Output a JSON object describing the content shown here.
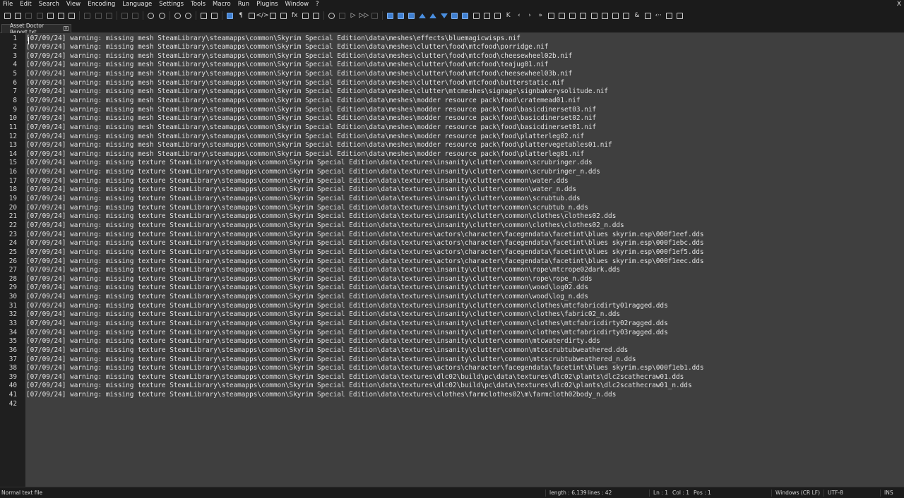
{
  "menu": {
    "items": [
      "File",
      "Edit",
      "Search",
      "View",
      "Encoding",
      "Language",
      "Settings",
      "Tools",
      "Macro",
      "Run",
      "Plugins",
      "Window",
      "?"
    ],
    "close_label": "X"
  },
  "toolbar": {
    "buttons": [
      {
        "name": "new-file-icon",
        "style": "",
        "disabled": false
      },
      {
        "name": "open-file-icon",
        "style": "",
        "disabled": false
      },
      {
        "name": "save-icon",
        "style": "",
        "disabled": true
      },
      {
        "name": "save-all-icon",
        "style": "",
        "disabled": true
      },
      {
        "name": "close-icon",
        "style": "",
        "disabled": false
      },
      {
        "name": "close-all-icon",
        "style": "",
        "disabled": false
      },
      {
        "name": "print-icon",
        "style": "",
        "disabled": false
      },
      {
        "sep": true
      },
      {
        "name": "cut-icon",
        "style": "",
        "disabled": true
      },
      {
        "name": "copy-icon",
        "style": "",
        "disabled": true
      },
      {
        "name": "paste-icon",
        "style": "",
        "disabled": true
      },
      {
        "sep": true
      },
      {
        "name": "undo-icon",
        "style": "",
        "disabled": true
      },
      {
        "name": "redo-icon",
        "style": "",
        "disabled": true
      },
      {
        "sep": true
      },
      {
        "name": "find-icon",
        "style": "round",
        "disabled": false
      },
      {
        "name": "replace-icon",
        "style": "round",
        "disabled": false
      },
      {
        "sep": true
      },
      {
        "name": "zoom-in-icon",
        "style": "round",
        "disabled": false
      },
      {
        "name": "zoom-out-icon",
        "style": "round",
        "disabled": false
      },
      {
        "sep": true
      },
      {
        "name": "sync-vertical-icon",
        "style": "",
        "disabled": false
      },
      {
        "name": "sync-horizontal-icon",
        "style": "",
        "disabled": false
      },
      {
        "sep": true
      },
      {
        "name": "word-wrap-icon",
        "style": "blue",
        "disabled": false
      },
      {
        "name": "show-all-characters-icon",
        "style": "glyph",
        "glyph": "¶",
        "disabled": false
      },
      {
        "name": "indent-guide-icon",
        "style": "",
        "disabled": false
      },
      {
        "name": "user-defined-language-icon",
        "style": "glyph",
        "glyph": "</>",
        "disabled": false
      },
      {
        "name": "document-map-icon",
        "style": "",
        "disabled": false
      },
      {
        "name": "document-list-icon",
        "style": "",
        "disabled": false
      },
      {
        "name": "function-list-icon",
        "style": "glyph",
        "glyph": "fx",
        "disabled": false
      },
      {
        "name": "folder-as-workspace-icon",
        "style": "",
        "disabled": false
      },
      {
        "name": "monitoring-icon",
        "style": "",
        "disabled": false
      },
      {
        "sep": true
      },
      {
        "name": "record-macro-icon",
        "style": "round",
        "disabled": false
      },
      {
        "name": "stop-recording-icon",
        "style": "",
        "disabled": true
      },
      {
        "name": "playback-macro-icon",
        "style": "glyph",
        "glyph": "▷",
        "disabled": false
      },
      {
        "name": "run-macro-multiple-icon",
        "style": "glyph",
        "glyph": "▷▷",
        "disabled": false
      },
      {
        "name": "save-macro-icon",
        "style": "",
        "disabled": true
      },
      {
        "sep": true
      },
      {
        "name": "plugin-1-icon",
        "style": "blue",
        "disabled": false
      },
      {
        "name": "plugin-2-icon",
        "style": "blue",
        "disabled": false
      },
      {
        "name": "plugin-3-icon",
        "style": "blue",
        "disabled": false
      },
      {
        "name": "plugin-4-icon",
        "style": "tri",
        "disabled": false
      },
      {
        "name": "plugin-5-icon",
        "style": "tri",
        "disabled": false
      },
      {
        "name": "plugin-6-icon",
        "style": "tri-down",
        "disabled": false
      },
      {
        "name": "plugin-7-icon",
        "style": "blue",
        "disabled": false
      },
      {
        "name": "plugin-8-icon",
        "style": "blue",
        "disabled": false
      },
      {
        "name": "plugin-9-icon",
        "style": "",
        "disabled": false
      },
      {
        "name": "plugin-10-icon",
        "style": "",
        "disabled": false
      },
      {
        "name": "plugin-11-icon",
        "style": "",
        "disabled": false
      },
      {
        "name": "plugin-12-icon",
        "style": "glyph",
        "glyph": "K",
        "disabled": false
      },
      {
        "name": "plugin-13-icon",
        "style": "glyph",
        "glyph": "‹",
        "disabled": false
      },
      {
        "name": "plugin-14-icon",
        "style": "glyph",
        "glyph": "›",
        "disabled": false
      },
      {
        "name": "plugin-15-icon",
        "style": "glyph",
        "glyph": "»",
        "disabled": false
      },
      {
        "name": "plugin-16-icon",
        "style": "",
        "disabled": false
      },
      {
        "name": "plugin-17-icon",
        "style": "",
        "disabled": false
      },
      {
        "name": "plugin-18-icon",
        "style": "",
        "disabled": false
      },
      {
        "name": "plugin-19-icon",
        "style": "",
        "disabled": false
      },
      {
        "name": "plugin-20-icon",
        "style": "",
        "disabled": false
      },
      {
        "name": "plugin-21-icon",
        "style": "",
        "disabled": false
      },
      {
        "name": "plugin-22-icon",
        "style": "",
        "disabled": false
      },
      {
        "name": "plugin-23-icon",
        "style": "",
        "disabled": false
      },
      {
        "name": "plugin-24-icon",
        "style": "glyph",
        "glyph": "&",
        "disabled": false
      },
      {
        "name": "plugin-25-icon",
        "style": "",
        "disabled": false
      },
      {
        "name": "plugin-26-icon",
        "style": "glyph",
        "glyph": "‹··",
        "disabled": false
      },
      {
        "name": "plugin-27-icon",
        "style": "",
        "disabled": false
      },
      {
        "name": "plugin-28-icon",
        "style": "",
        "disabled": false
      }
    ]
  },
  "tab": {
    "title": "Asset Doctor Report.txt",
    "close_glyph": "×"
  },
  "editor": {
    "lines": [
      "[07/09/24] warning: missing mesh SteamLibrary\\steamapps\\common\\Skyrim Special Edition\\data\\meshes\\effects\\bluemagicwisps.nif",
      "[07/09/24] warning: missing mesh SteamLibrary\\steamapps\\common\\Skyrim Special Edition\\data\\meshes\\clutter\\food\\mtcfood\\porridge.nif",
      "[07/09/24] warning: missing mesh SteamLibrary\\steamapps\\common\\Skyrim Special Edition\\data\\meshes\\clutter\\food\\mtcfood\\cheesewheel02b.nif",
      "[07/09/24] warning: missing mesh SteamLibrary\\steamapps\\common\\Skyrim Special Edition\\data\\meshes\\clutter\\food\\mtcfood\\teajug01.nif",
      "[07/09/24] warning: missing mesh SteamLibrary\\steamapps\\common\\Skyrim Special Edition\\data\\meshes\\clutter\\food\\mtcfood\\cheesewheel03b.nif",
      "[07/09/24] warning: missing mesh SteamLibrary\\steamapps\\common\\Skyrim Special Edition\\data\\meshes\\clutter\\food\\mtcfood\\butterstatic.nif",
      "[07/09/24] warning: missing mesh SteamLibrary\\steamapps\\common\\Skyrim Special Edition\\data\\meshes\\clutter\\mtcmeshes\\signage\\signbakerysolitude.nif",
      "[07/09/24] warning: missing mesh SteamLibrary\\steamapps\\common\\Skyrim Special Edition\\data\\meshes\\modder resource pack\\food\\cratemead01.nif",
      "[07/09/24] warning: missing mesh SteamLibrary\\steamapps\\common\\Skyrim Special Edition\\data\\meshes\\modder resource pack\\food\\basicdinerset03.nif",
      "[07/09/24] warning: missing mesh SteamLibrary\\steamapps\\common\\Skyrim Special Edition\\data\\meshes\\modder resource pack\\food\\basicdinerset02.nif",
      "[07/09/24] warning: missing mesh SteamLibrary\\steamapps\\common\\Skyrim Special Edition\\data\\meshes\\modder resource pack\\food\\basicdinerset01.nif",
      "[07/09/24] warning: missing mesh SteamLibrary\\steamapps\\common\\Skyrim Special Edition\\data\\meshes\\modder resource pack\\food\\platterleg02.nif",
      "[07/09/24] warning: missing mesh SteamLibrary\\steamapps\\common\\Skyrim Special Edition\\data\\meshes\\modder resource pack\\food\\plattervegetables01.nif",
      "[07/09/24] warning: missing mesh SteamLibrary\\steamapps\\common\\Skyrim Special Edition\\data\\meshes\\modder resource pack\\food\\platterleg01.nif",
      "[07/09/24] warning: missing texture SteamLibrary\\steamapps\\common\\Skyrim Special Edition\\data\\textures\\insanity\\clutter\\common\\scrubringer.dds",
      "[07/09/24] warning: missing texture SteamLibrary\\steamapps\\common\\Skyrim Special Edition\\data\\textures\\insanity\\clutter\\common\\scrubringer_n.dds",
      "[07/09/24] warning: missing texture SteamLibrary\\steamapps\\common\\Skyrim Special Edition\\data\\textures\\insanity\\clutter\\common\\water.dds",
      "[07/09/24] warning: missing texture SteamLibrary\\steamapps\\common\\Skyrim Special Edition\\data\\textures\\insanity\\clutter\\common\\water_n.dds",
      "[07/09/24] warning: missing texture SteamLibrary\\steamapps\\common\\Skyrim Special Edition\\data\\textures\\insanity\\clutter\\common\\scrubtub.dds",
      "[07/09/24] warning: missing texture SteamLibrary\\steamapps\\common\\Skyrim Special Edition\\data\\textures\\insanity\\clutter\\common\\scrubtub_n.dds",
      "[07/09/24] warning: missing texture SteamLibrary\\steamapps\\common\\Skyrim Special Edition\\data\\textures\\insanity\\clutter\\common\\clothes\\clothes02.dds",
      "[07/09/24] warning: missing texture SteamLibrary\\steamapps\\common\\Skyrim Special Edition\\data\\textures\\insanity\\clutter\\common\\clothes\\clothes02_n.dds",
      "[07/09/24] warning: missing texture SteamLibrary\\steamapps\\common\\Skyrim Special Edition\\data\\textures\\actors\\character\\facegendata\\facetint\\blues skyrim.esp\\000f1eef.dds",
      "[07/09/24] warning: missing texture SteamLibrary\\steamapps\\common\\Skyrim Special Edition\\data\\textures\\actors\\character\\facegendata\\facetint\\blues skyrim.esp\\000f1ebc.dds",
      "[07/09/24] warning: missing texture SteamLibrary\\steamapps\\common\\Skyrim Special Edition\\data\\textures\\actors\\character\\facegendata\\facetint\\blues skyrim.esp\\000f1ef5.dds",
      "[07/09/24] warning: missing texture SteamLibrary\\steamapps\\common\\Skyrim Special Edition\\data\\textures\\actors\\character\\facegendata\\facetint\\blues skyrim.esp\\000f1eec.dds",
      "[07/09/24] warning: missing texture SteamLibrary\\steamapps\\common\\Skyrim Special Edition\\data\\textures\\insanity\\clutter\\common\\rope\\mtcrope02dark.dds",
      "[07/09/24] warning: missing texture SteamLibrary\\steamapps\\common\\Skyrim Special Edition\\data\\textures\\insanity\\clutter\\common\\rope\\rope_n.dds",
      "[07/09/24] warning: missing texture SteamLibrary\\steamapps\\common\\Skyrim Special Edition\\data\\textures\\insanity\\clutter\\common\\wood\\log02.dds",
      "[07/09/24] warning: missing texture SteamLibrary\\steamapps\\common\\Skyrim Special Edition\\data\\textures\\insanity\\clutter\\common\\wood\\log_n.dds",
      "[07/09/24] warning: missing texture SteamLibrary\\steamapps\\common\\Skyrim Special Edition\\data\\textures\\insanity\\clutter\\common\\clothes\\mtcfabricdirty01ragged.dds",
      "[07/09/24] warning: missing texture SteamLibrary\\steamapps\\common\\Skyrim Special Edition\\data\\textures\\insanity\\clutter\\common\\clothes\\fabric02_n.dds",
      "[07/09/24] warning: missing texture SteamLibrary\\steamapps\\common\\Skyrim Special Edition\\data\\textures\\insanity\\clutter\\common\\clothes\\mtcfabricdirty02ragged.dds",
      "[07/09/24] warning: missing texture SteamLibrary\\steamapps\\common\\Skyrim Special Edition\\data\\textures\\insanity\\clutter\\common\\clothes\\mtcfabricdirty03ragged.dds",
      "[07/09/24] warning: missing texture SteamLibrary\\steamapps\\common\\Skyrim Special Edition\\data\\textures\\insanity\\clutter\\common\\mtcwaterdirty.dds",
      "[07/09/24] warning: missing texture SteamLibrary\\steamapps\\common\\Skyrim Special Edition\\data\\textures\\insanity\\clutter\\common\\mtcscrubtubweathered.dds",
      "[07/09/24] warning: missing texture SteamLibrary\\steamapps\\common\\Skyrim Special Edition\\data\\textures\\insanity\\clutter\\common\\mtcscrubtubweathered_n.dds",
      "[07/09/24] warning: missing texture SteamLibrary\\steamapps\\common\\Skyrim Special Edition\\data\\textures\\actors\\character\\facegendata\\facetint\\blues skyrim.esp\\000f1eb1.dds",
      "[07/09/24] warning: missing texture SteamLibrary\\steamapps\\common\\Skyrim Special Edition\\data\\textures\\dlc02\\build\\pc\\data\\textures\\dlc02\\plants\\dlc2scathecraw01.dds",
      "[07/09/24] warning: missing texture SteamLibrary\\steamapps\\common\\Skyrim Special Edition\\data\\textures\\dlc02\\build\\pc\\data\\textures\\dlc02\\plants\\dlc2scathecraw01_n.dds",
      "[07/09/24] warning: missing texture SteamLibrary\\steamapps\\common\\Skyrim Special Edition\\data\\textures\\clothes\\farmclothes02\\m\\farmcloth02body_n.dds",
      ""
    ]
  },
  "status": {
    "file_type": "Normal text file",
    "length": "length : 6,139",
    "lines": "lines : 42",
    "ln": "Ln : 1",
    "col": "Col : 1",
    "pos": "Pos : 1",
    "eol": "Windows (CR LF)",
    "encoding": "UTF-8",
    "mode": "INS"
  },
  "colors": {
    "editor_bg": "#3f3f3f",
    "gutter_bg": "#1f1f1f",
    "chrome_bg": "#1b1b1b",
    "accent": "#3f7fd0"
  }
}
